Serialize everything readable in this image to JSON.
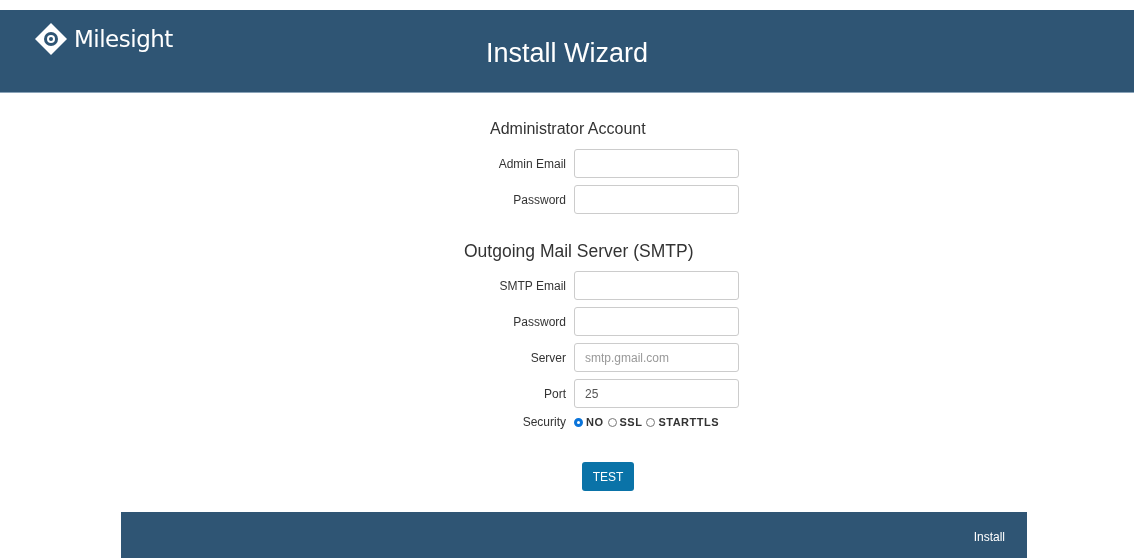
{
  "header": {
    "logo_text": "Milesight",
    "title": "Install Wizard"
  },
  "sections": [
    {
      "heading": "Administrator Account",
      "fields": [
        {
          "label": "Admin Email"
        },
        {
          "label": "Password"
        }
      ]
    },
    {
      "heading": "Outgoing Mail Server (SMTP)",
      "fields": [
        {
          "label": "SMTP Email"
        },
        {
          "label": "Password"
        },
        {
          "label": "Server",
          "placeholder": "smtp.gmail.com"
        },
        {
          "label": "Port",
          "value": "25"
        }
      ]
    }
  ],
  "security": {
    "label": "Security",
    "options": [
      {
        "label": "NO",
        "selected": true
      },
      {
        "label": "SSL",
        "selected": false
      },
      {
        "label": "STARTTLS",
        "selected": false
      }
    ]
  },
  "test_button": "TEST",
  "footer": {
    "install": "Install"
  }
}
